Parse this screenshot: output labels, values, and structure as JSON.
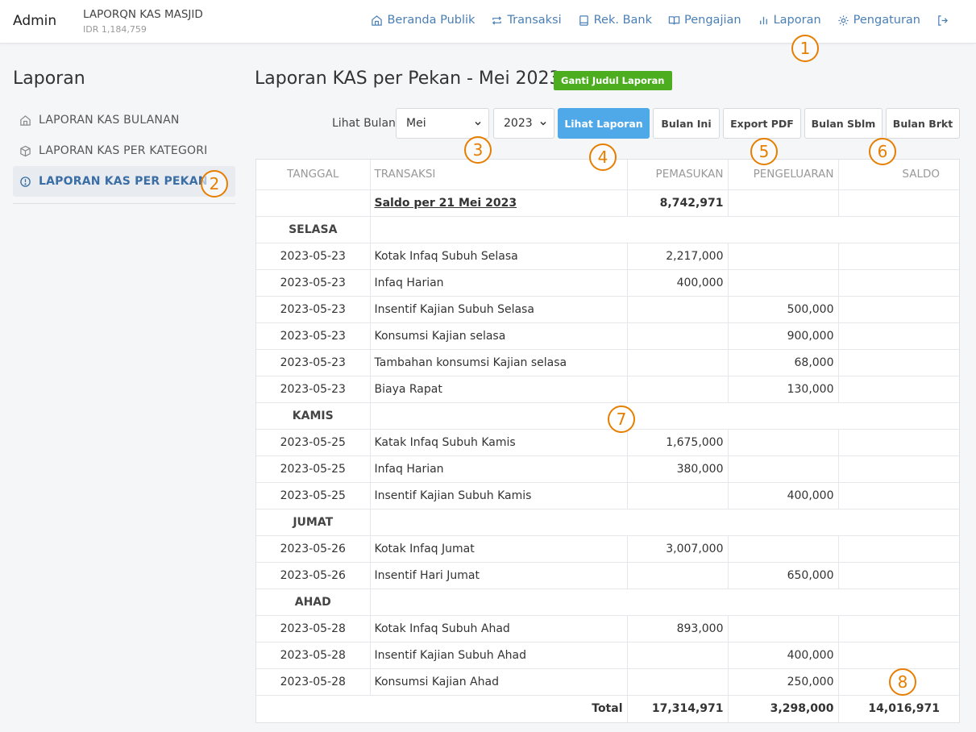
{
  "navbar": {
    "brand": "Admin",
    "app_name": "LAPORQN KAS MASJID",
    "app_balance": "IDR 1,184,759",
    "items": [
      {
        "label": "Beranda Publik",
        "icon": "home-icon"
      },
      {
        "label": "Transaksi",
        "icon": "repeat-icon"
      },
      {
        "label": "Rek. Bank",
        "icon": "book-icon"
      },
      {
        "label": "Pengajian",
        "icon": "open-book-icon"
      },
      {
        "label": "Laporan",
        "icon": "bar-chart-icon"
      },
      {
        "label": "Pengaturan",
        "icon": "gear-icon"
      }
    ],
    "logout_icon": "logout-icon"
  },
  "sidebar": {
    "title": "Laporan",
    "items": [
      {
        "label": "LAPORAN KAS BULANAN",
        "icon": "home-icon",
        "active": false
      },
      {
        "label": "LAPORAN KAS PER KATEGORI",
        "icon": "box-icon",
        "active": false
      },
      {
        "label": "LAPORAN KAS PER PEKAN",
        "icon": "alert-circle-icon",
        "active": true
      }
    ]
  },
  "page": {
    "title": "Laporan KAS per Pekan - Mei 2023",
    "rename_button": "Ganti Judul Laporan"
  },
  "toolbar": {
    "month_label": "Lihat Bulan",
    "month_value": "Mei",
    "year_value": "2023",
    "view_button": "Lihat Laporan",
    "this_month_button": "Bulan Ini",
    "export_button": "Export PDF",
    "prev_month_button": "Bulan Sblm",
    "next_month_button": "Bulan Brkt"
  },
  "table": {
    "headers": {
      "date": "TANGGAL",
      "transaction": "TRANSAKSI",
      "income": "PEMASUKAN",
      "expense": "PENGELUARAN",
      "balance": "SALDO"
    },
    "opening": {
      "label": "Saldo per 21 Mei 2023",
      "income": "8,742,971"
    },
    "days": {
      "selasa": "SELASA",
      "kamis": "KAMIS",
      "jumat": "JUMAT",
      "ahad": "AHAD"
    },
    "rows": [
      {
        "date": "2023-05-23",
        "desc": "Kotak Infaq Subuh Selasa",
        "income": "2,217,000",
        "expense": ""
      },
      {
        "date": "2023-05-23",
        "desc": "Infaq Harian",
        "income": "400,000",
        "expense": ""
      },
      {
        "date": "2023-05-23",
        "desc": "Insentif Kajian Subuh Selasa",
        "income": "",
        "expense": "500,000"
      },
      {
        "date": "2023-05-23",
        "desc": "Konsumsi Kajian selasa",
        "income": "",
        "expense": "900,000"
      },
      {
        "date": "2023-05-23",
        "desc": "Tambahan konsumsi Kajian selasa",
        "income": "",
        "expense": "68,000"
      },
      {
        "date": "2023-05-23",
        "desc": "Biaya Rapat",
        "income": "",
        "expense": "130,000"
      },
      {
        "date": "2023-05-25",
        "desc": "Katak Infaq Subuh Kamis",
        "income": "1,675,000",
        "expense": ""
      },
      {
        "date": "2023-05-25",
        "desc": "Infaq Harian",
        "income": "380,000",
        "expense": ""
      },
      {
        "date": "2023-05-25",
        "desc": "Insentif Kajian Subuh Kamis",
        "income": "",
        "expense": "400,000"
      },
      {
        "date": "2023-05-26",
        "desc": "Kotak Infaq Jumat",
        "income": "3,007,000",
        "expense": ""
      },
      {
        "date": "2023-05-26",
        "desc": "Insentif Hari Jumat",
        "income": "",
        "expense": "650,000"
      },
      {
        "date": "2023-05-28",
        "desc": "Kotak Infaq Subuh Ahad",
        "income": "893,000",
        "expense": ""
      },
      {
        "date": "2023-05-28",
        "desc": "Insentif Kajian Subuh Ahad",
        "income": "",
        "expense": "400,000"
      },
      {
        "date": "2023-05-28",
        "desc": "Konsumsi Kajian Ahad",
        "income": "",
        "expense": "250,000"
      }
    ],
    "total": {
      "label": "Total",
      "income": "17,314,971",
      "expense": "3,298,000",
      "balance": "14,016,971"
    }
  },
  "markers": [
    "1",
    "2",
    "3",
    "4",
    "5",
    "6",
    "7",
    "8"
  ],
  "colors": {
    "accent": "#4fa8e8",
    "link": "#4a7fb5",
    "rename": "#4cae1f",
    "marker": "#e67e00"
  }
}
